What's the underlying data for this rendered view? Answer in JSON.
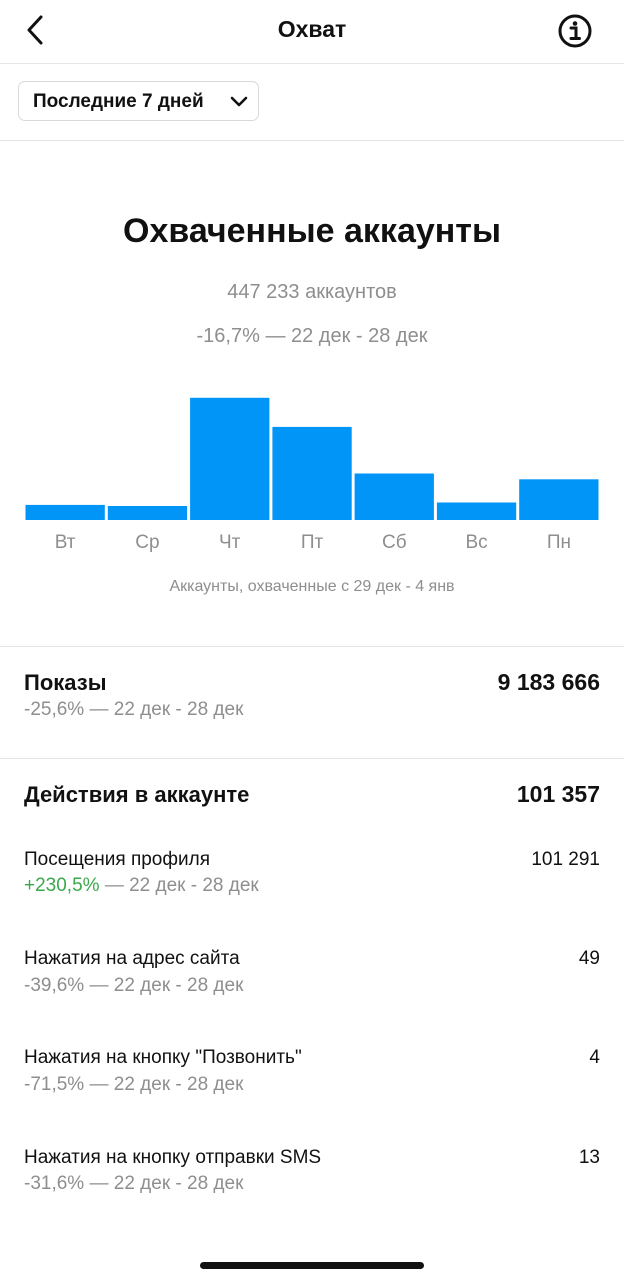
{
  "header": {
    "title": "Охват"
  },
  "filter": {
    "label": "Последние 7 дней"
  },
  "summary": {
    "title": "Охваченные аккаунты",
    "count": "447 233 аккаунтов",
    "change": "-16,7% — 22 дек - 28 дек",
    "caption": "Аккаунты, охваченные с 29 дек - 4 янв"
  },
  "chart_data": {
    "type": "bar",
    "categories": [
      "Вт",
      "Ср",
      "Чт",
      "Пт",
      "Сб",
      "Вс",
      "Пн"
    ],
    "values": [
      13,
      12,
      105,
      80,
      40,
      15,
      35
    ],
    "ylim": [
      0,
      110
    ],
    "color": "#0095f6",
    "grid": false
  },
  "impressions": {
    "label": "Показы",
    "value": "9 183 666",
    "change": "-25,6% — 22 дек - 28 дек"
  },
  "actions": {
    "label": "Действия в аккаунте",
    "value": "101 357",
    "items": [
      {
        "label": "Посещения профиля",
        "value": "101 291",
        "change_pct": "+230,5%",
        "period": " — 22 дек - 28 дек",
        "positive": true
      },
      {
        "label": "Нажатия на адрес сайта",
        "value": "49",
        "change_pct": "-39,6%",
        "period": " — 22 дек - 28 дек",
        "positive": false
      },
      {
        "label": "Нажатия на кнопку \"Позвонить\"",
        "value": "4",
        "change_pct": "-71,5%",
        "period": " — 22 дек - 28 дек",
        "positive": false
      },
      {
        "label": "Нажатия на кнопку отправки SMS",
        "value": "13",
        "change_pct": "-31,6%",
        "period": " — 22 дек - 28 дек",
        "positive": false
      }
    ]
  },
  "icons": {
    "back": "chevron-left-icon",
    "info": "info-icon",
    "dropdown": "chevron-down-icon"
  },
  "colors": {
    "accent": "#0095f6",
    "positive": "#3aa84a",
    "muted": "#8e8e8e"
  }
}
